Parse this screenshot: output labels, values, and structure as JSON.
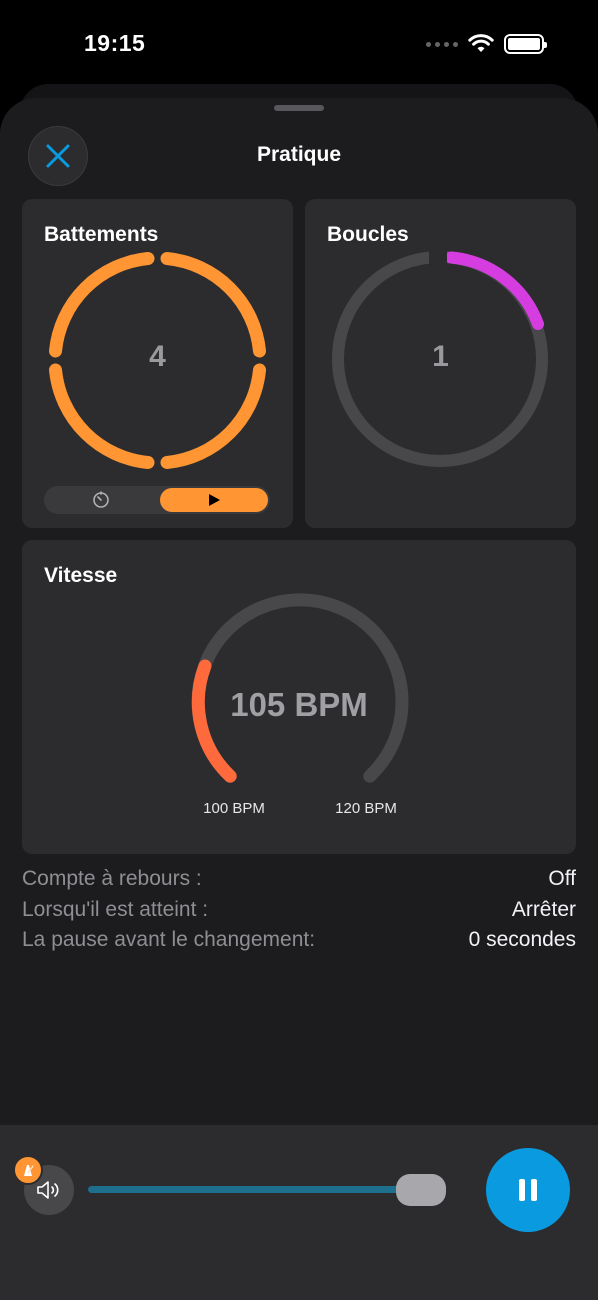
{
  "status_bar": {
    "time": "19:15"
  },
  "header": {
    "title": "Pratique"
  },
  "beats": {
    "title": "Battements",
    "value": "4",
    "color": "#ff9633"
  },
  "loops": {
    "title": "Boucles",
    "value": "1",
    "color": "#d63de0",
    "track_color": "#48484a"
  },
  "speed": {
    "title": "Vitesse",
    "value": "105 BPM",
    "min_label": "100 BPM",
    "max_label": "120 BPM",
    "min": 100,
    "max": 120,
    "current": 105,
    "accent_color": "#ff6a3d"
  },
  "settings": [
    {
      "label": "Compte à rebours :",
      "value": "Off"
    },
    {
      "label": "Lorsqu'il est atteint :",
      "value": "Arrêter"
    },
    {
      "label": "La pause avant le changement:",
      "value": "0 secondes"
    }
  ],
  "player": {
    "volume_level": 0.95,
    "accent": "#0a9ae0"
  },
  "icons": {
    "close": "close-icon",
    "timer": "timer-icon",
    "play": "play-icon",
    "volume": "speaker-icon",
    "alert": "metronome-alert-icon",
    "pause": "pause-icon"
  }
}
